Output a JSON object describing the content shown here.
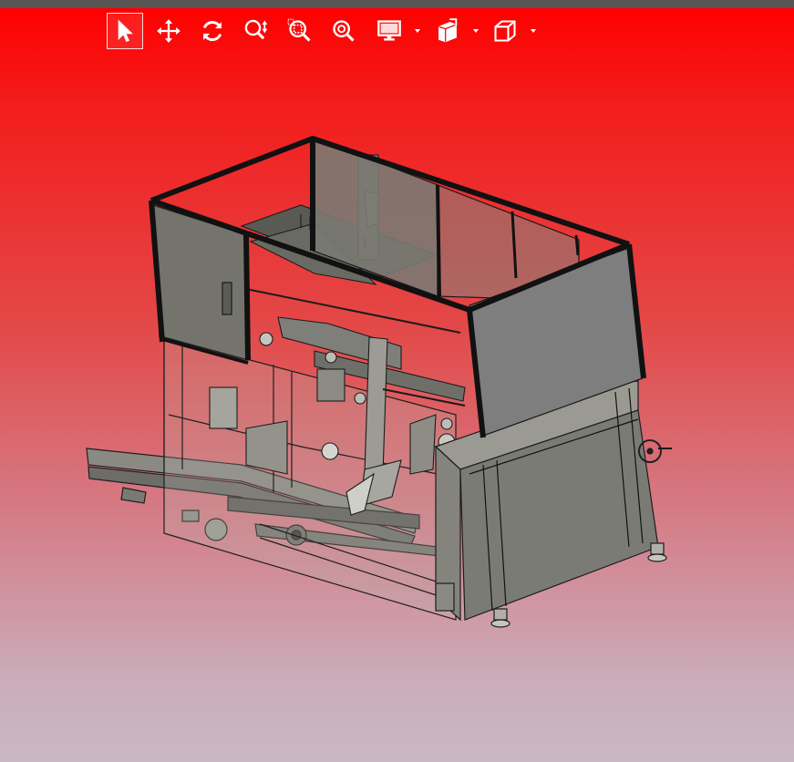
{
  "window": {
    "topbar_color": "#5a5555"
  },
  "viewport": {
    "background_top": "#ff0000",
    "background_bottom": "#c9b8c5"
  },
  "toolbar": {
    "tools": [
      {
        "name": "select-tool",
        "icon": "arrow-pointer-icon",
        "active": true
      },
      {
        "name": "pan-tool",
        "icon": "move-arrows-icon",
        "active": false
      },
      {
        "name": "rotate-tool",
        "icon": "rotate-icon",
        "active": false
      },
      {
        "name": "zoom-tool",
        "icon": "zoom-updown-icon",
        "active": false
      },
      {
        "name": "zoom-window-tool",
        "icon": "zoom-window-icon",
        "active": false
      },
      {
        "name": "zoom-fit-tool",
        "icon": "zoom-fit-icon",
        "active": false
      },
      {
        "name": "display-mode-menu",
        "icon": "monitor-icon",
        "has_dropdown": true
      },
      {
        "name": "section-menu",
        "icon": "section-cube-icon",
        "has_dropdown": true
      },
      {
        "name": "view-orientation-menu",
        "icon": "wire-cube-icon",
        "has_dropdown": true
      }
    ]
  },
  "model": {
    "description_icon": "3d-cad-machine-assembly",
    "frame_color": "#2b2b2b",
    "panel_color": "#7d7d78",
    "steel_color": "#8e8e86"
  }
}
